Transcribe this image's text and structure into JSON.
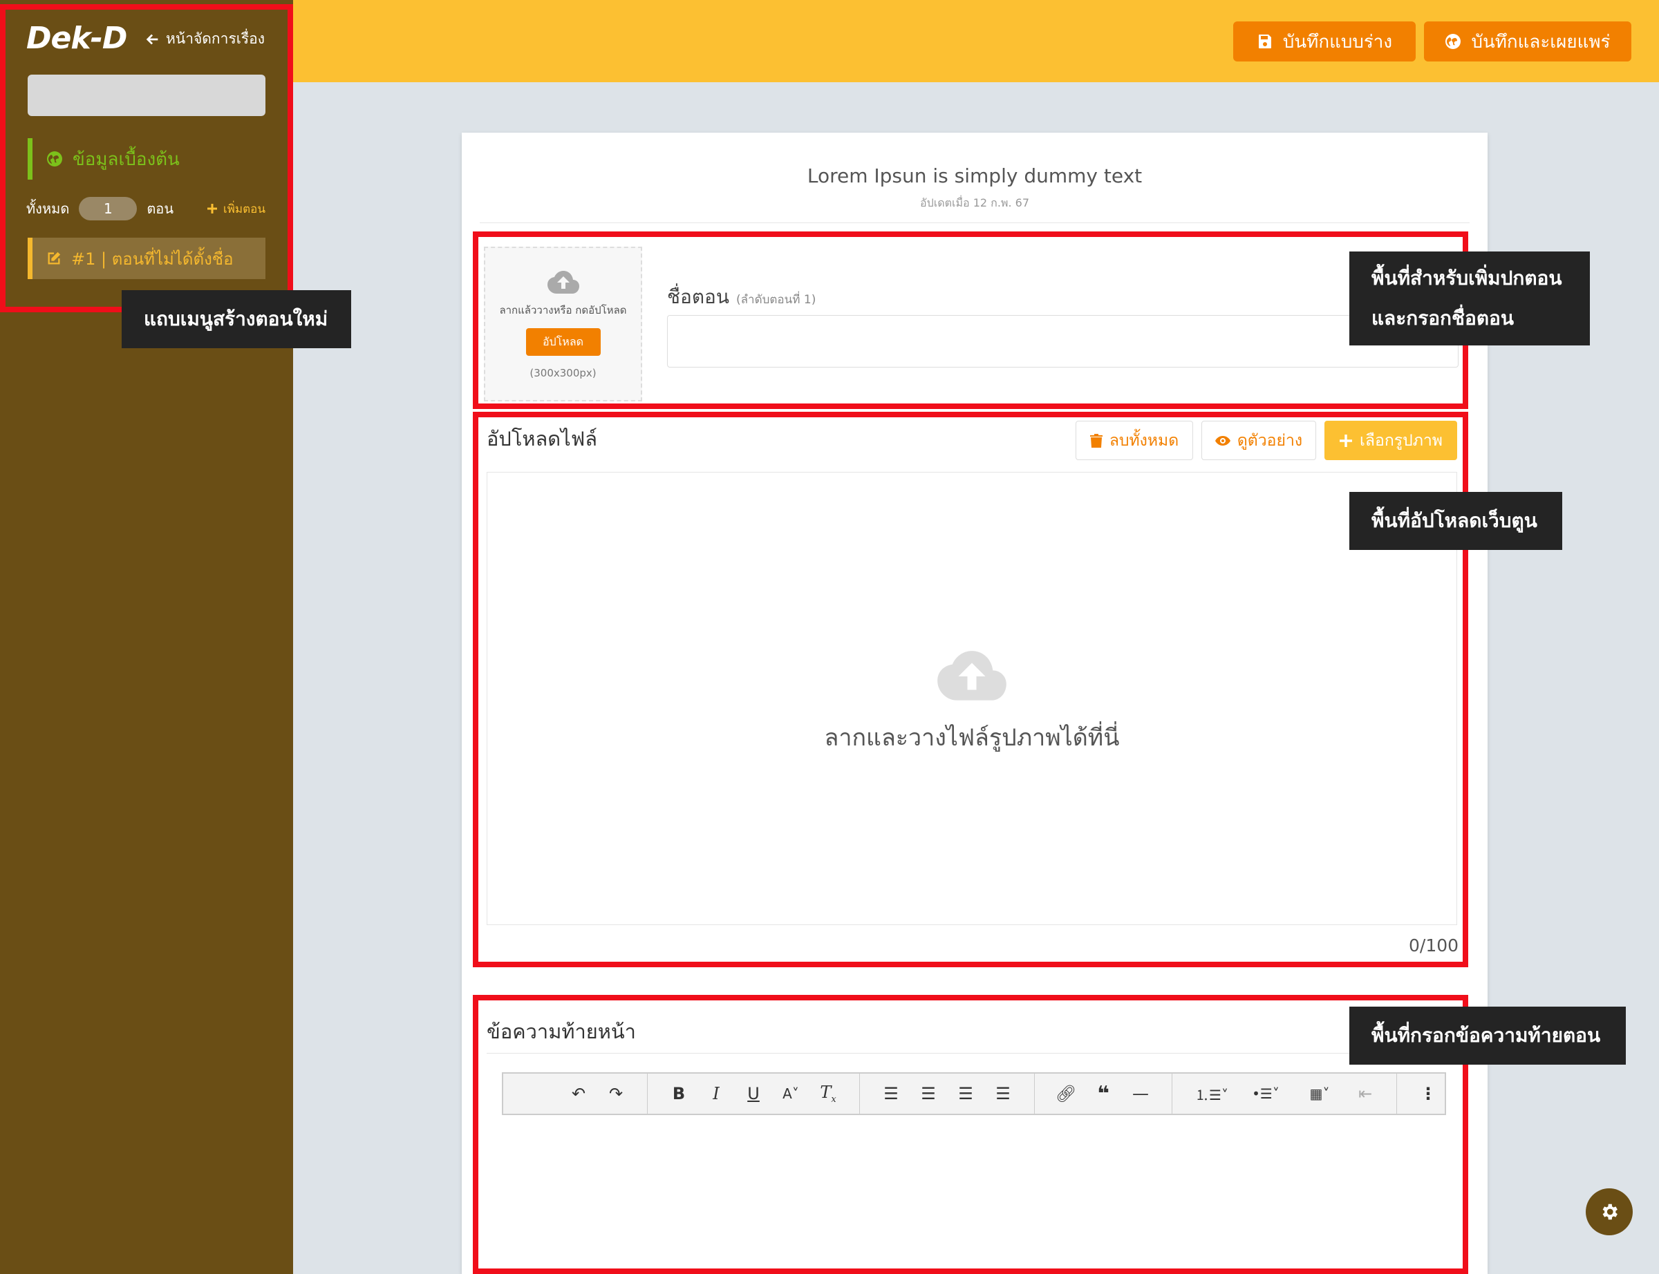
{
  "header": {
    "save_draft_label": "บันทึกแบบร่าง",
    "save_publish_label": "บันทึกและเผยแพร่",
    "accent_color": "#fcc032",
    "button_color": "#f28000"
  },
  "sidebar": {
    "logo": "Dek-D",
    "back_label": "หน้าจัดการเรื่อง",
    "basic_info_label": "ข้อมูลเบื้องต้น",
    "total_label": "ทั้งหมด",
    "episode_count": "1",
    "episode_unit": "ตอน",
    "add_episode_label": "เพิ่มตอน",
    "episode_item_label": "#1 | ตอนที่ไม่ได้ตั้งชื่อ",
    "background_color": "#6a4e15"
  },
  "annotations": {
    "sidebar_label": "แถบเมนูสร้างตอนใหม่",
    "cover_label_line1": "พื้นที่สำหรับเพิ่มปกตอน",
    "cover_label_line2": "และกรอกชื่อตอน",
    "upload_label": "พื้นที่อัปโหลดเว็บตูน",
    "footer_label": "พื้นที่กรอกข้อความท้ายตอน",
    "box_color": "#f00e1a"
  },
  "story": {
    "title": "Lorem Ipsun is simply dummy text",
    "updated": "อัปเดตเมื่อ 12 ก.พ. 67"
  },
  "cover": {
    "hint": "ลากแล้ววางหรือ กดอัปโหลด",
    "upload_button": "อัปโหลด",
    "size_hint": "(300x300px)"
  },
  "episode_name": {
    "label": "ชื่อตอน",
    "sub_label": "(ลำดับตอนที่ 1)",
    "value": ""
  },
  "upload": {
    "title": "อัปโหลดไฟล์",
    "delete_all_label": "ลบทั้งหมด",
    "preview_label": "ดูตัวอย่าง",
    "choose_image_label": "เลือกรูปภาพ",
    "drop_text": "ลากและวางไฟล์รูปภาพได้ที่นี่",
    "file_count": "0/100"
  },
  "footer_message": {
    "title": "ข้อความท้ายหน้า",
    "value": "",
    "toolbar_icons": [
      "undo-icon",
      "redo-icon",
      "bold-icon",
      "italic-icon",
      "underline-icon",
      "font-color-icon",
      "clear-format-icon",
      "align-left-icon",
      "align-center-icon",
      "align-right-icon",
      "align-justify-icon",
      "link-icon",
      "quote-icon",
      "horizontal-rule-icon",
      "numbered-list-icon",
      "bullet-list-icon",
      "table-icon",
      "outdent-icon",
      "more-icon"
    ]
  }
}
